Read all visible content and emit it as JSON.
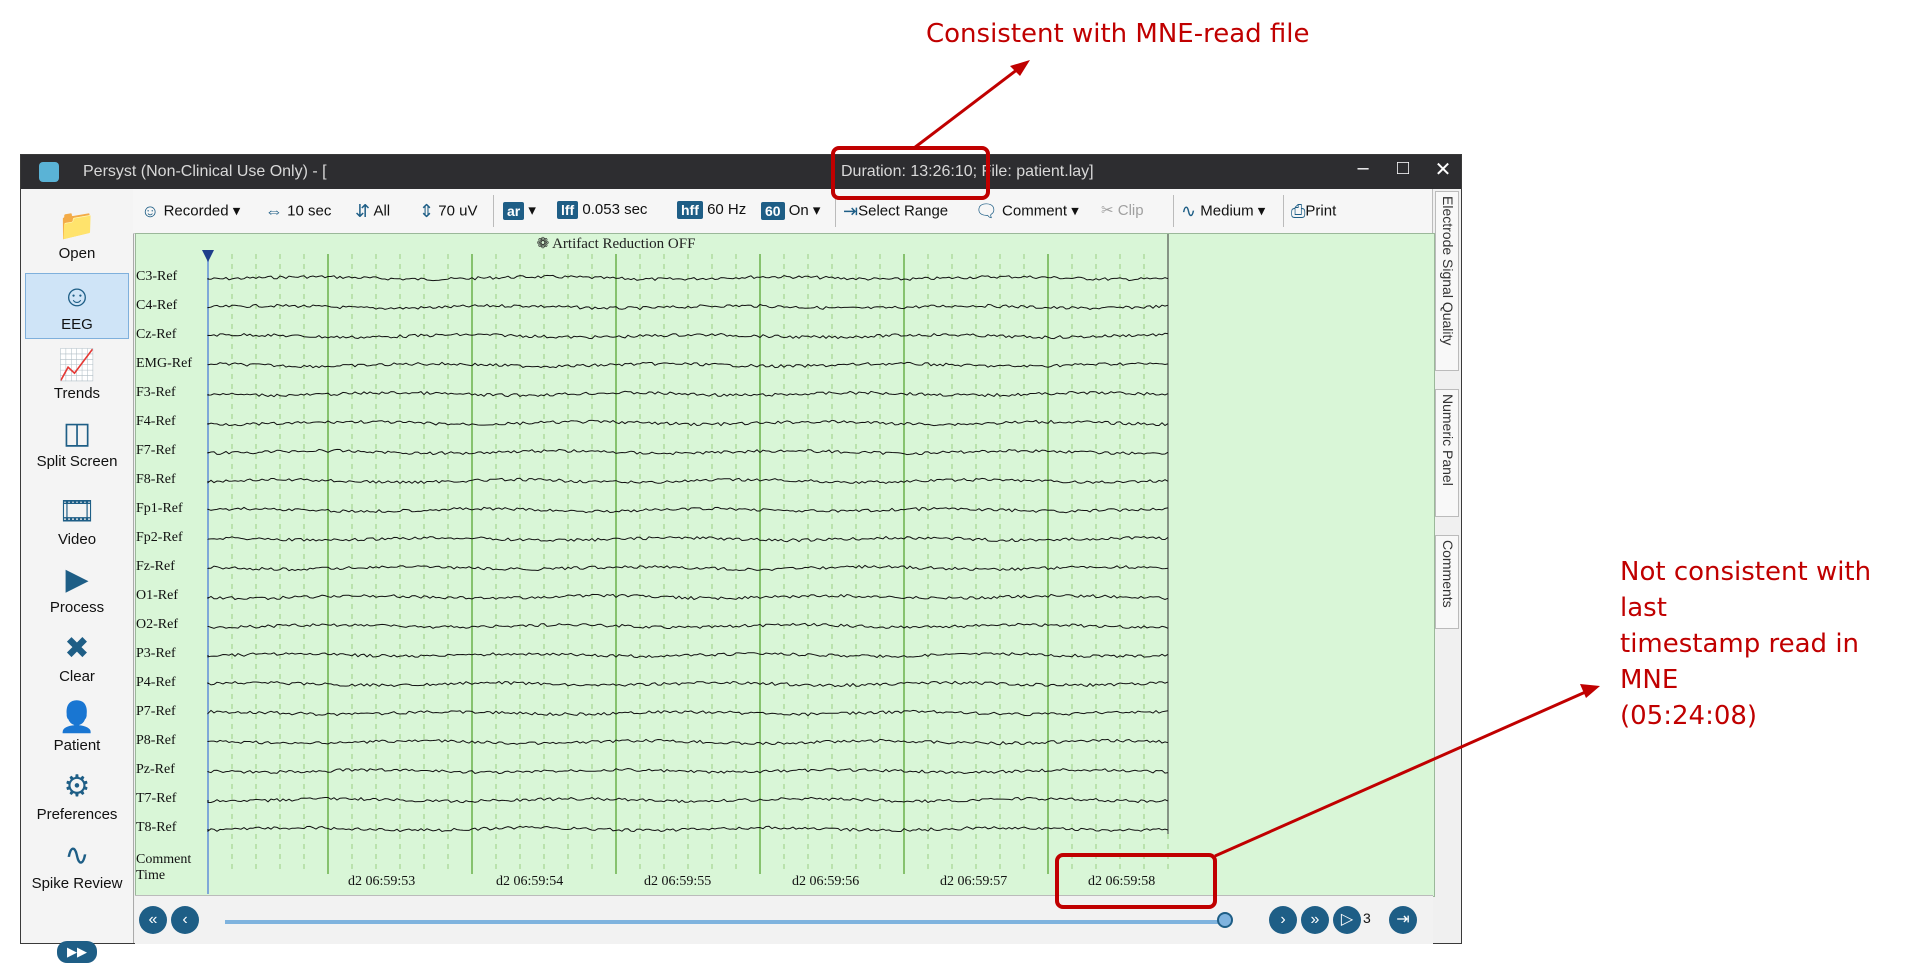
{
  "annotations": {
    "top_text": "Consistent with MNE-read file",
    "right_text": "Not consistent with last\ntimestamp read in MNE\n(05:24:08)"
  },
  "window": {
    "title": "Persyst (Non-Clinical Use Only) - [",
    "duration_text": "Duration: 13:26:10; File: patient.lay]",
    "minimize": "–",
    "maximize": "□",
    "close": "✕"
  },
  "sidebar": {
    "items": [
      {
        "label": "Open",
        "icon": "folder-icon"
      },
      {
        "label": "EEG",
        "icon": "eeg-head-icon"
      },
      {
        "label": "Trends",
        "icon": "trends-icon"
      },
      {
        "label": "Split Screen",
        "icon": "split-screen-icon"
      },
      {
        "label": "Video",
        "icon": "video-film-icon"
      },
      {
        "label": "Process",
        "icon": "process-icon"
      },
      {
        "label": "Clear",
        "icon": "clear-x-icon"
      },
      {
        "label": "Patient",
        "icon": "patient-icon"
      },
      {
        "label": "Preferences",
        "icon": "gear-icon"
      },
      {
        "label": "Spike Review",
        "icon": "spike-icon"
      }
    ],
    "expand_label": "▶▶"
  },
  "toolbar": {
    "recorded": "Recorded",
    "timebase": "10 sec",
    "montage": "All",
    "sensitivity": "70 uV",
    "ar": "ar",
    "lff": "lff",
    "lff_value": "0.053 sec",
    "hff": "hff",
    "hff_value": "60 Hz",
    "notch": "60",
    "notch_value": "On",
    "select_range": "Select Range",
    "comment": "Comment",
    "clip": "Clip",
    "medium": "Medium",
    "print": "Print"
  },
  "right_tabs": [
    "Electrode Signal Quality",
    "Numeric Panel",
    "Comments"
  ],
  "plot": {
    "artifact_text": "Artifact Reduction OFF",
    "channels": [
      "C3-Ref",
      "C4-Ref",
      "Cz-Ref",
      "EMG-Ref",
      "F3-Ref",
      "F4-Ref",
      "F7-Ref",
      "F8-Ref",
      "Fp1-Ref",
      "Fp2-Ref",
      "Fz-Ref",
      "O1-Ref",
      "O2-Ref",
      "P3-Ref",
      "P4-Ref",
      "P7-Ref",
      "P8-Ref",
      "Pz-Ref",
      "T7-Ref",
      "T8-Ref"
    ],
    "comment_label": "Comment",
    "time_label": "Time",
    "time_ticks": [
      "d2 06:59:53",
      "d2 06:59:54",
      "d2 06:59:55",
      "d2 06:59:56",
      "d2 06:59:57",
      "d2 06:59:58"
    ]
  },
  "navbar": {
    "first": "«",
    "prev": "‹",
    "next": "›",
    "fast_forward": "»",
    "play": "▷",
    "page_count": "3",
    "end": "⇥"
  },
  "colors": {
    "annotation": "#c00000",
    "accent": "#1e5e86",
    "plot_bg": "#d9f6d7"
  }
}
